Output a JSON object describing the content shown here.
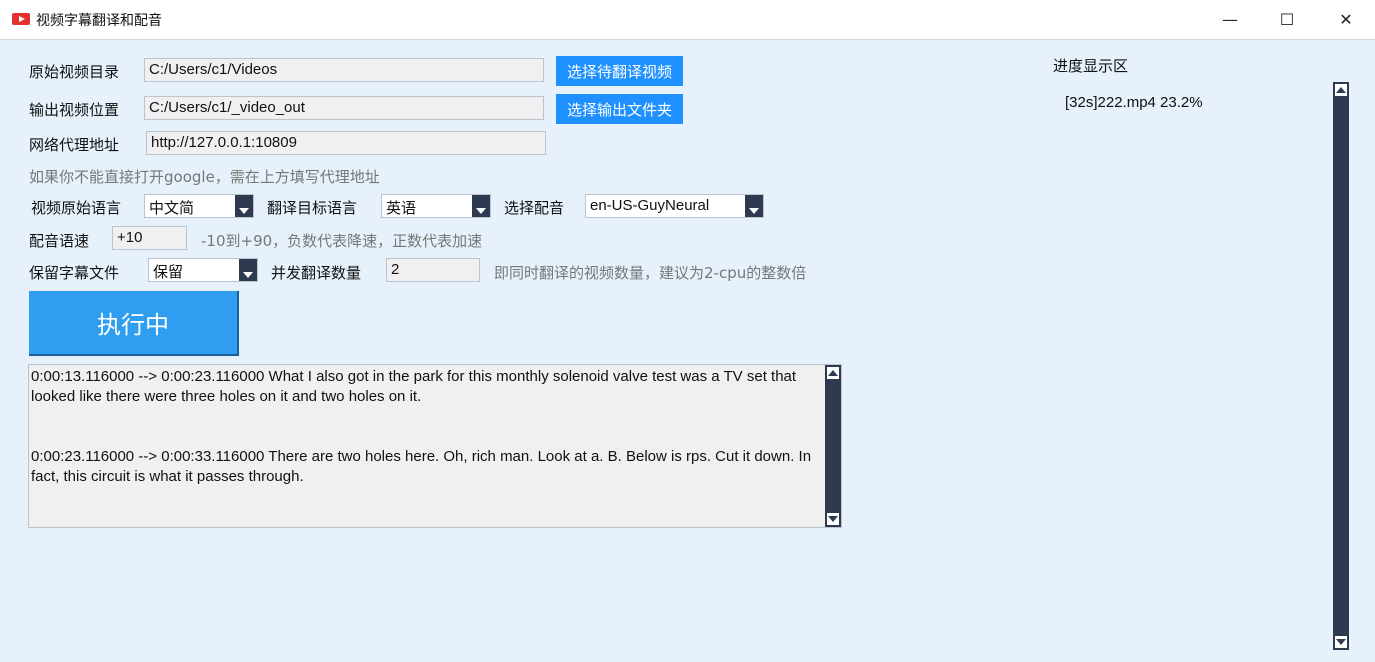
{
  "window": {
    "title": "视频字幕翻译和配音",
    "minimize": "—",
    "maximize": "☐",
    "close": "✕"
  },
  "source_dir": {
    "label": "原始视频目录",
    "value": "C:/Users/c1/Videos",
    "button": "选择待翻译视频"
  },
  "output_dir": {
    "label": "输出视频位置",
    "value": "C:/Users/c1/_video_out",
    "button": "选择输出文件夹"
  },
  "proxy": {
    "label": "网络代理地址",
    "value": "http://127.0.0.1:10809",
    "hint": "如果你不能直接打开google，需在上方填写代理地址"
  },
  "languages": {
    "source_label": "视频原始语言",
    "source_value": "中文简",
    "target_label": "翻译目标语言",
    "target_value": "英语",
    "voice_label": "选择配音",
    "voice_value": "en-US-GuyNeural"
  },
  "speed": {
    "label": "配音语速",
    "value": "+10",
    "hint": "-10到+90，负数代表降速，正数代表加速"
  },
  "subtitle": {
    "label": "保留字幕文件",
    "value": "保留"
  },
  "concurrency": {
    "label": "并发翻译数量",
    "value": "2",
    "hint": "即同时翻译的视频数量，建议为2-cpu的整数倍"
  },
  "run_button": "执行中",
  "log": [
    "0:00:13.116000 --> 0:00:23.116000 What I also got in the park for this monthly solenoid valve test was a TV set that looked like there were three holes on it and two holes on it.",
    "0:00:23.116000 --> 0:00:33.116000 There are two holes here. Oh, rich man. Look at a. B. Below is rps. Cut it down. In fact, this circuit is what it passes through."
  ],
  "progress": {
    "title": "进度显示区",
    "items": [
      "[32s]222.mp4 23.2%"
    ]
  },
  "colors": {
    "accent": "#1e90ff",
    "run_button": "#2f9ef0",
    "background": "#e6f1fb",
    "scrollbar": "#2e3a4f"
  }
}
